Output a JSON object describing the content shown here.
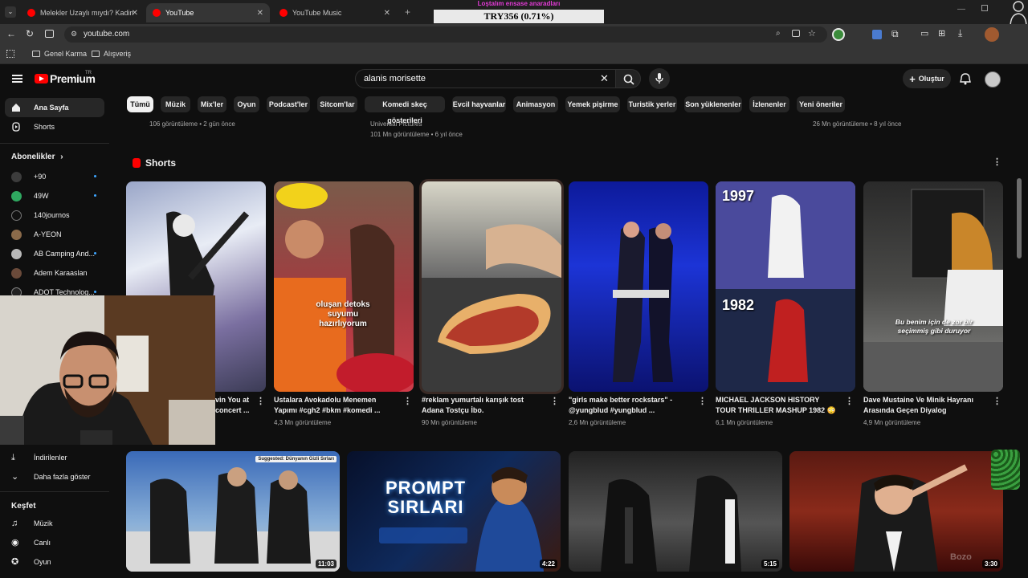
{
  "browser": {
    "tabs": [
      {
        "title": "Melekler Uzaylı mıydı? Kadim M"
      },
      {
        "title": "YouTube"
      },
      {
        "title": "YouTube Music"
      }
    ],
    "url": "youtube.com",
    "bookmarks": [
      {
        "label": "Genel Karma"
      },
      {
        "label": "Alışveriş"
      }
    ]
  },
  "ticker": {
    "top_text": "Loştalım ensase anaradları",
    "price": "TRY356 (0.71%)"
  },
  "header": {
    "logo": "Premium",
    "region": "TR",
    "search_value": "alanis morisette",
    "create_label": "Oluştur"
  },
  "chips": [
    "Tümü",
    "Müzik",
    "Mix'ler",
    "Oyun",
    "Podcast'ler",
    "Sitcom'lar",
    "Komedi skeç gösterileri",
    "Evcil hayvanlar",
    "Animasyon",
    "Yemek pişirme",
    "Turistik yerler",
    "Son yüklenenler",
    "İzlenenler",
    "Yeni öneriler"
  ],
  "sidebar": {
    "home": "Ana Sayfa",
    "shorts": "Shorts",
    "subscriptions_heading": "Abonelikler",
    "subscriptions": [
      "+90",
      "49W",
      "140journos",
      "A-YEON",
      "AB Camping And...",
      "Adem Karaaslan",
      "ADOT Technolog..."
    ],
    "downloads": "İndirilenler",
    "show_more": "Daha fazla göster",
    "explore_heading": "Keşfet",
    "explore": [
      "Müzik",
      "Canlı",
      "Oyun"
    ]
  },
  "top_row_meta": [
    {
      "line1": "106 görüntüleme • 2 gün önce"
    },
    {
      "line1": "Universal Pictures",
      "line2": "101 Mn görüntüleme • 6 yıl önce"
    },
    {
      "line1": "26 Mn görüntüleme • 8 yıl önce"
    }
  ],
  "shorts_heading": "Shorts",
  "shorts": [
    {
      "title": "vin You at concert ...",
      "views": ""
    },
    {
      "title": "Ustalara Avokadolu Menemen Yapımı #cgh2 #bkm #komedi ...",
      "views": "4,3 Mn görüntüleme",
      "overlay": "oluşan detoks suyumu hazırlıyorum"
    },
    {
      "title": "#reklam yumurtalı karışık tost Adana Tostçu İbo.",
      "views": "90 Mn görüntüleme"
    },
    {
      "title": "\"girls make better rockstars\" - @yungblud #yungblud ...",
      "views": "2,6 Mn görüntüleme"
    },
    {
      "title": "MICHAEL JACKSON HISTORY TOUR THRILLER MASHUP 1982 😳",
      "views": "6,1 Mn görüntüleme",
      "overlay_top": "1997",
      "overlay_bottom": "1982"
    },
    {
      "title": "Dave Mustaine Ve Minik Hayranı Arasında Geçen Diyalog",
      "views": "4,9 Mn görüntüleme",
      "overlay": "Bu benim için de zor bir seçimmiş gibi duruyor"
    }
  ],
  "videos": [
    {
      "duration": "11:03",
      "overlay": "Suggested: Dünyanın Gizli Sırları"
    },
    {
      "duration": "4:22",
      "overlay": "PROMPT SIRLARI"
    },
    {
      "duration": "5:15"
    },
    {
      "duration": "3:30",
      "overlay": "Bozo"
    }
  ],
  "colors": {
    "background": "#0f0f0f",
    "brand_red": "#ff0000",
    "chip_bg": "#272727",
    "ticker_magenta": "#e23bd6"
  }
}
